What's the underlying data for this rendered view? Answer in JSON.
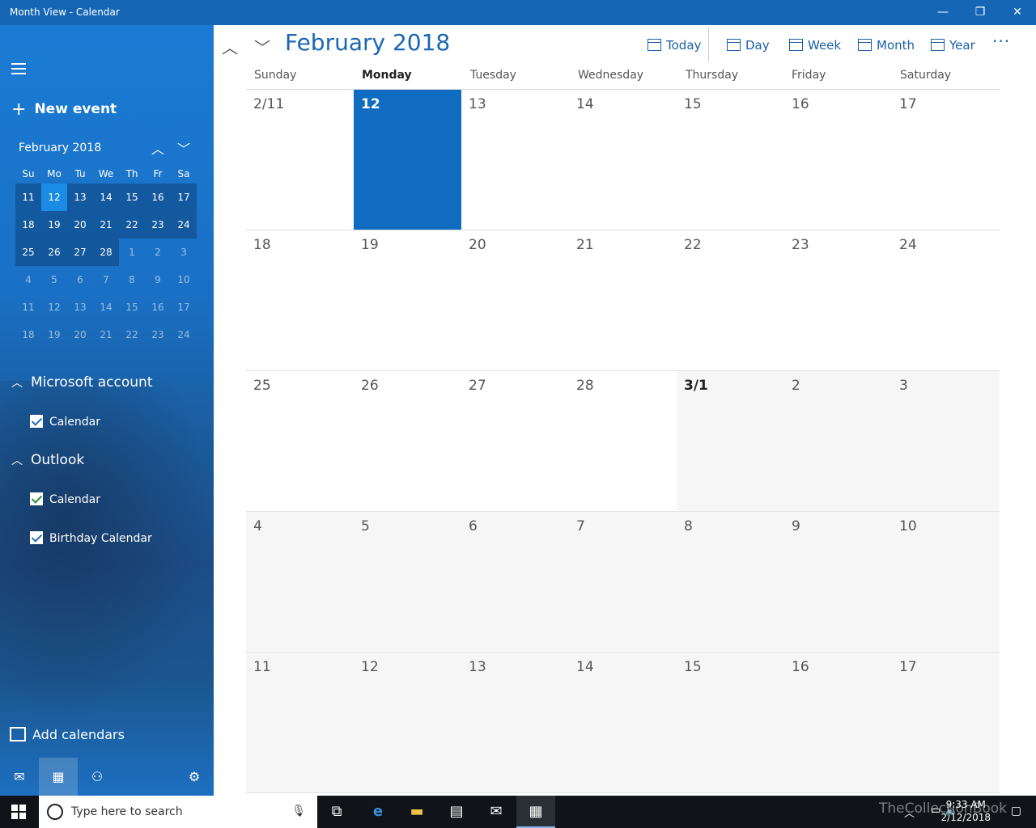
{
  "window": {
    "title": "Month View - Calendar",
    "minimize": "—",
    "restore": "❐",
    "close": "✕"
  },
  "sidebar": {
    "new_event": "New event",
    "mini_calendar": {
      "title": "February 2018",
      "day_headers": [
        "Su",
        "Mo",
        "Tu",
        "We",
        "Th",
        "Fr",
        "Sa"
      ],
      "weeks": [
        [
          "11",
          "12",
          "13",
          "14",
          "15",
          "16",
          "17"
        ],
        [
          "18",
          "19",
          "20",
          "21",
          "22",
          "23",
          "24"
        ],
        [
          "25",
          "26",
          "27",
          "28",
          "1",
          "2",
          "3"
        ],
        [
          "4",
          "5",
          "6",
          "7",
          "8",
          "9",
          "10"
        ],
        [
          "11",
          "12",
          "13",
          "14",
          "15",
          "16",
          "17"
        ],
        [
          "18",
          "19",
          "20",
          "21",
          "22",
          "23",
          "24"
        ]
      ]
    },
    "accounts": [
      {
        "name": "Microsoft account",
        "calendars": [
          "Calendar"
        ]
      },
      {
        "name": "Outlook",
        "calendars": [
          "Calendar",
          "Birthday Calendar"
        ]
      }
    ],
    "add_calendars": "Add calendars"
  },
  "main": {
    "month_title": "February 2018",
    "toolbar": {
      "today": "Today",
      "day": "Day",
      "week": "Week",
      "month": "Month",
      "year": "Year",
      "more": "···"
    },
    "day_headers": [
      "Sunday",
      "Monday",
      "Tuesday",
      "Wednesday",
      "Thursday",
      "Friday",
      "Saturday"
    ],
    "weeks": [
      [
        "2/11",
        "12",
        "13",
        "14",
        "15",
        "16",
        "17"
      ],
      [
        "18",
        "19",
        "20",
        "21",
        "22",
        "23",
        "24"
      ],
      [
        "25",
        "26",
        "27",
        "28",
        "3/1",
        "2",
        "3"
      ],
      [
        "4",
        "5",
        "6",
        "7",
        "8",
        "9",
        "10"
      ],
      [
        "11",
        "12",
        "13",
        "14",
        "15",
        "16",
        "17"
      ]
    ]
  },
  "taskbar": {
    "search_placeholder": "Type here to search",
    "time": "9:33 AM",
    "date": "2/12/2018",
    "watermark": "TheCollectionBook"
  }
}
